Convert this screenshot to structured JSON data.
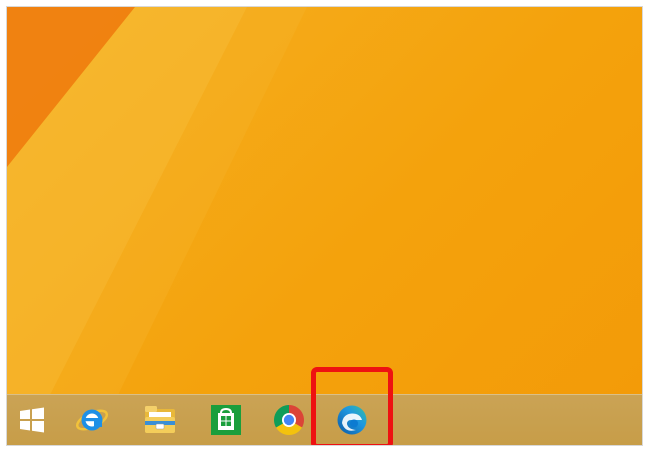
{
  "desktop": {
    "wallpaper": {
      "base_color": "#f4a20c",
      "accent_color": "#ef7d10",
      "highlight_color": "#f8c040"
    }
  },
  "taskbar": {
    "background_color": "#c9a14f",
    "items": [
      {
        "name": "start",
        "icon": "windows-logo-icon",
        "color": "#ffffff"
      },
      {
        "name": "internet-explorer",
        "icon": "internet-explorer-icon",
        "color": "#1e90e6"
      },
      {
        "name": "file-explorer",
        "icon": "folder-icon",
        "color": "#f2c040"
      },
      {
        "name": "store",
        "icon": "store-icon",
        "color": "#1a9e3c"
      },
      {
        "name": "chrome",
        "icon": "chrome-icon",
        "color": "#db4437"
      },
      {
        "name": "edge",
        "icon": "edge-icon",
        "color": "#0c7bd1"
      }
    ],
    "highlighted_item": "edge",
    "highlight_color": "#ee1111"
  }
}
